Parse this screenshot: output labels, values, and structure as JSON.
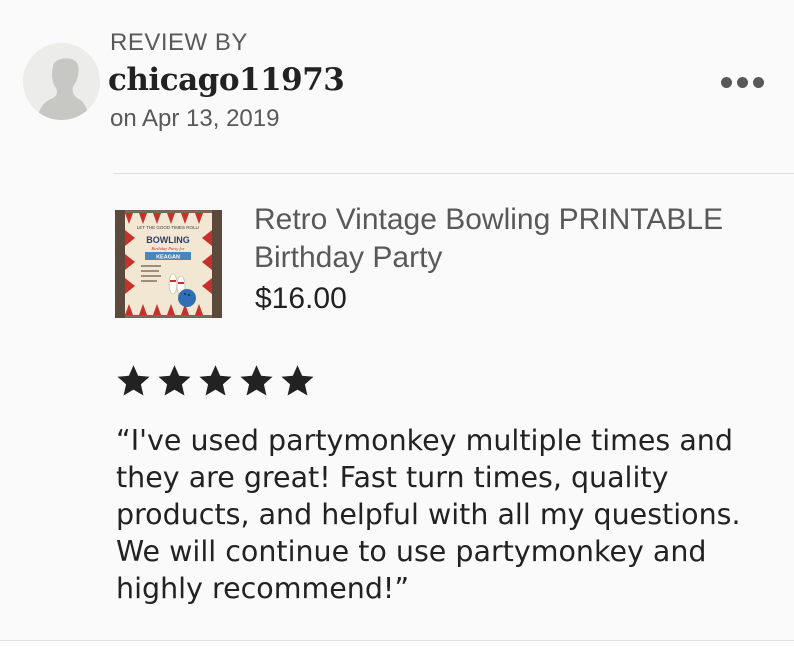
{
  "review": {
    "header_label": "REVIEW BY",
    "username": "chicago11973",
    "date": "on Apr 13, 2019",
    "rating": 5,
    "text": "“I've used partymonkey multiple times and they are great! Fast turn times, quality products, and helpful with all my questions. We will continue to use partymonkey and highly recommend!”"
  },
  "listing": {
    "title": "Retro Vintage Bowling PRINTABLE Birthday Party",
    "price": "$16.00",
    "thumbnail": {
      "banner": "LET THE GOOD TIMES ROLL!",
      "headline": "BOWLING",
      "subline": "Birthday Party for",
      "name": "KEAGAN"
    }
  },
  "icons": {
    "more": "more-options-icon",
    "avatar": "default-avatar-icon",
    "star": "star-icon"
  },
  "colors": {
    "background": "#fafafa",
    "text_primary": "#222222",
    "text_secondary": "#595959",
    "star": "#222222",
    "divider": "#e1e1e1"
  }
}
